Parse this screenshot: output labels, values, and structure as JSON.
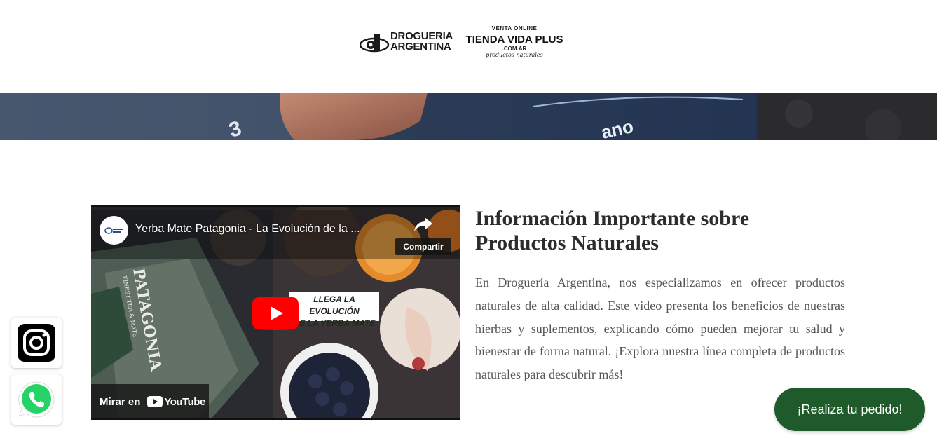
{
  "header": {
    "logo_drogueria_line1": "DROGUERIA",
    "logo_drogueria_line2": "ARGENTINA",
    "logo_tienda_top": "VENTA ONLINE",
    "logo_tienda_main": "TIENDA VIDA PLUS",
    "logo_tienda_domain": ".COM.AR",
    "logo_tienda_tagline": "productos naturales"
  },
  "video": {
    "title": "Yerba Mate Patagonia - La Evolución de la ...",
    "share_label": "Compartir",
    "overlay_line1": "LLEGA LA EVOLUCIÓN",
    "overlay_line2": "DE LA YERBA MATE",
    "watch_on_label": "Mirar en",
    "youtube_label": "YouTube",
    "package_brand": "PATAGONIA",
    "package_sub": "FINEST TEA & MATE"
  },
  "info": {
    "heading": "Información Importante sobre Productos Naturales",
    "body": "En Droguería Argentina, nos especializamos en ofrecer productos naturales de alta calidad. Este video presenta los beneficios de nuestras hierbas y suplementos, explicando cómo pueden mejorar tu salud y bienestar de forma natural. ¡Explora nuestra línea completa de productos naturales para descubrir más!"
  },
  "floating": {
    "instagram_icon": "instagram-icon",
    "whatsapp_icon": "whatsapp-icon"
  },
  "order_button": {
    "label": "¡Realiza tu pedido!"
  },
  "colors": {
    "order_button_bg": "#1f5a2a",
    "youtube_red": "#ff0000",
    "whatsapp_green": "#25d366",
    "heading_text": "#2c2c2c",
    "body_text": "#555555"
  }
}
